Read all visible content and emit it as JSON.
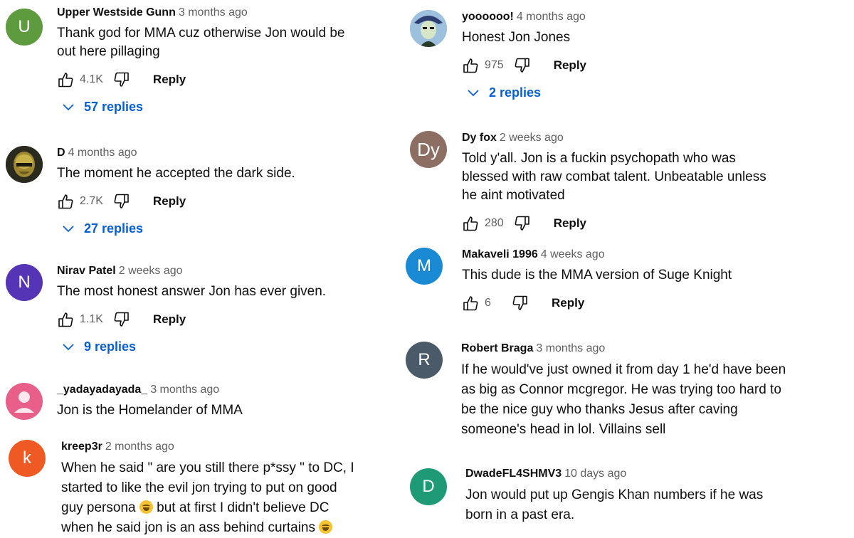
{
  "action_labels": {
    "reply": "Reply"
  },
  "colors": {
    "link_blue": "#065fd4",
    "meta_gray": "#606060"
  },
  "comments": [
    {
      "author": "Upper Westside Gunn",
      "time": "3 months ago",
      "avatar": {
        "letter": "U",
        "color": "#5e9b3e"
      },
      "text": "Thank god for MMA cuz otherwise Jon would be out here pillaging",
      "likes": "4.1K",
      "replies": "57 replies"
    },
    {
      "author": "D",
      "time": "4 months ago",
      "avatar": {
        "kind": "image",
        "icon": "helmet-avatar-image"
      },
      "text": "The moment he accepted the dark side.",
      "likes": "2.7K",
      "replies": "27 replies"
    },
    {
      "author": "Nirav Patel",
      "time": "2 weeks ago",
      "avatar": {
        "letter": "N",
        "color": "#5535b5"
      },
      "text": "The most honest answer Jon has ever given.",
      "likes": "1.1K",
      "replies": "9 replies"
    },
    {
      "author": "_yadayadayada_",
      "time": "3 months ago",
      "avatar": {
        "kind": "default",
        "icon": "default-person-avatar",
        "color": "#e85f8a"
      },
      "text": "Jon is the Homelander of MMA"
    },
    {
      "author": "kreep3r",
      "time": "2 months ago",
      "avatar": {
        "letter": "k",
        "color": "#ef5a24"
      },
      "text_parts": [
        "When he said \" are you still there p*ssy \" to DC, I started to like the evil jon trying to put on good guy persona ",
        " but at first I didn't believe DC when he said jon is an ass behind curtains "
      ],
      "emoji": "laughing-emoji"
    },
    {
      "author": "yoooooo!",
      "time": "4 months ago",
      "avatar": {
        "kind": "image",
        "icon": "anime-avatar-image"
      },
      "text": "Honest Jon Jones",
      "likes": "975",
      "replies": "2 replies"
    },
    {
      "author": "Dy fox",
      "time": "2 weeks ago",
      "avatar": {
        "letter": "Dy",
        "color": "#8d6e63"
      },
      "text": "Told y'all. Jon is a fuckin psychopath who was blessed with raw combat talent. Unbeatable unless he aint motivated",
      "likes": "280"
    },
    {
      "author": "Makaveli 1996",
      "time": "4 weeks ago",
      "avatar": {
        "letter": "M",
        "color": "#1a8ad4"
      },
      "text": "This dude is the MMA version of Suge Knight",
      "likes": "6"
    },
    {
      "author": "Robert Braga",
      "time": "3 months ago",
      "avatar": {
        "letter": "R",
        "color": "#4a5a68"
      },
      "text": "If he would've just owned it from day 1 he'd have been as big as Connor mcgregor.  He was trying too hard to be the nice guy who thanks Jesus after caving someone's head in lol. Villains sell"
    },
    {
      "author": "DwadeFL4SHMV3",
      "time": "10 days ago",
      "avatar": {
        "letter": "D",
        "color": "#1e9a76"
      },
      "text": "Jon would put up Gengis Khan numbers if he was born in a past era."
    }
  ]
}
